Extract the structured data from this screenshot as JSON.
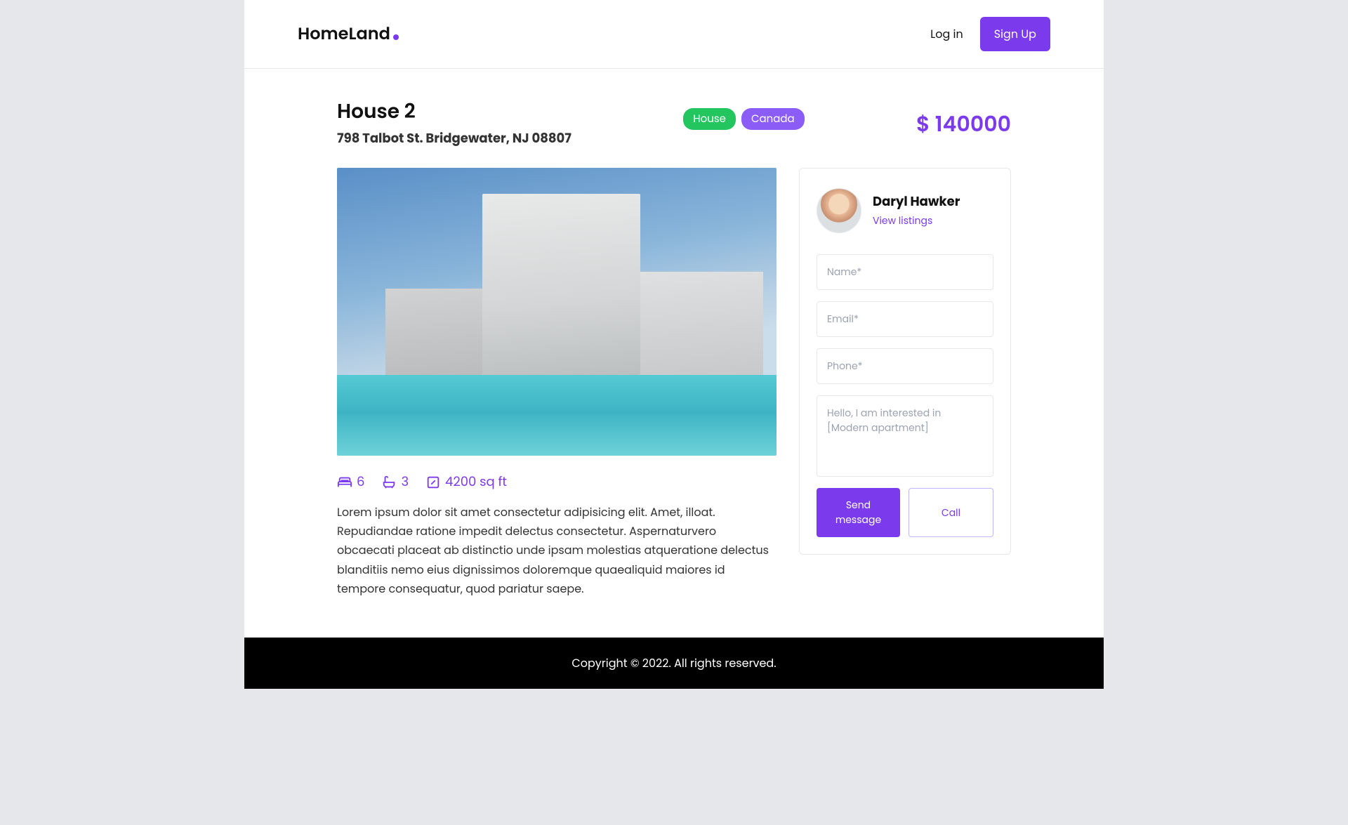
{
  "header": {
    "logo": "HomeLand",
    "login": "Log in",
    "signup": "Sign Up"
  },
  "listing": {
    "title": "House 2",
    "address": "798 Talbot St. Bridgewater, NJ 08807",
    "tags": {
      "type": "House",
      "country": "Canada"
    },
    "price": "$ 140000",
    "features": {
      "beds": "6",
      "baths": "3",
      "area": "4200 sq ft"
    },
    "description": "Lorem ipsum dolor sit amet consectetur adipisicing elit. Amet, illoat. Repudiandae ratione impedit delectus consectetur. Aspernaturvero obcaecati placeat ab distinctio unde ipsam molestias atqueratione delectus blanditiis nemo eius dignissimos doloremque quaealiquid maiores id tempore consequatur, quod pariatur saepe."
  },
  "agent": {
    "name": "Daryl Hawker",
    "view_listings": "View listings"
  },
  "form": {
    "name_placeholder": "Name*",
    "email_placeholder": "Email*",
    "phone_placeholder": "Phone*",
    "message_placeholder": "Hello, I am interested in [Modern apartment]",
    "send": "Send message",
    "call": "Call"
  },
  "footer": {
    "copyright": "Copyright © 2022. All rights reserved."
  }
}
